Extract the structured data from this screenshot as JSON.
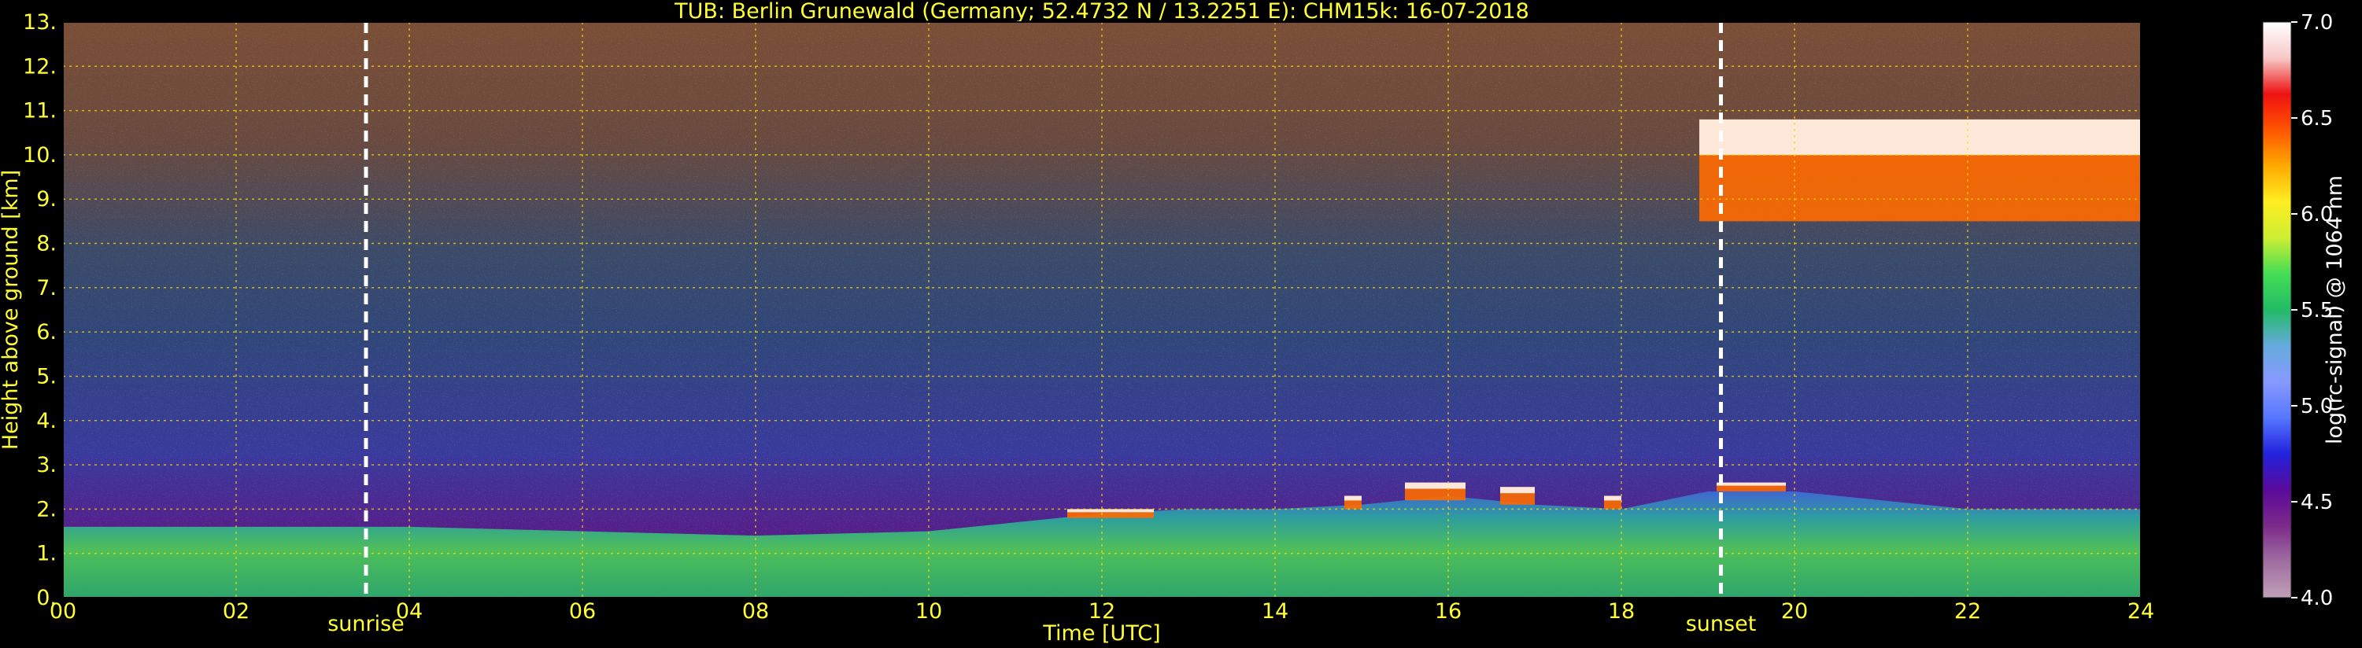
{
  "chart_data": {
    "type": "heatmap",
    "title": "TUB: Berlin Grunewald (Germany; 52.4732 N / 13.2251 E):    CHM15k: 16-07-2018",
    "xlabel": "Time [UTC]",
    "ylabel": "Height above ground [km]",
    "xlim": [
      0,
      24
    ],
    "ylim": [
      0,
      13
    ],
    "x_ticks": [
      "00",
      "02",
      "04",
      "06",
      "08",
      "10",
      "12",
      "14",
      "16",
      "18",
      "20",
      "22",
      "24"
    ],
    "y_ticks": [
      "0.",
      "1.",
      "2.",
      "3.",
      "4.",
      "5.",
      "6.",
      "7.",
      "8.",
      "9.",
      "10.",
      "11.",
      "12.",
      "13."
    ],
    "grid": true,
    "annotations": [
      {
        "label": "sunrise",
        "x": 3.5
      },
      {
        "label": "sunset",
        "x": 19.15
      }
    ],
    "colorbar": {
      "label": "log(rc-signal) @ 1064 nm",
      "range": [
        4.0,
        7.0
      ],
      "ticks": [
        "4.0",
        "4.5",
        "5.0",
        "5.5",
        "6.0",
        "6.5",
        "7.0"
      ],
      "colors": [
        "#c0a0b8",
        "#a06ea0",
        "#7c2a8a",
        "#5a0a9a",
        "#2222dd",
        "#5577ff",
        "#8899ff",
        "#66aadd",
        "#22bb66",
        "#44dd55",
        "#ccee33",
        "#ffee22",
        "#ffaa00",
        "#ff5500",
        "#ee1111",
        "#f8c8c8",
        "#ffffff"
      ]
    },
    "boundary_layer_top_km": [
      [
        0,
        1.6
      ],
      [
        2,
        1.6
      ],
      [
        4,
        1.6
      ],
      [
        6,
        1.5
      ],
      [
        8,
        1.4
      ],
      [
        10,
        1.5
      ],
      [
        11,
        1.7
      ],
      [
        12,
        1.9
      ],
      [
        13,
        2.0
      ],
      [
        14,
        2.0
      ],
      [
        15,
        2.1
      ],
      [
        16,
        2.3
      ],
      [
        17,
        2.1
      ],
      [
        18,
        2.0
      ],
      [
        19,
        2.4
      ],
      [
        20,
        2.4
      ],
      [
        21,
        2.2
      ],
      [
        22,
        2.0
      ],
      [
        24,
        2.0
      ]
    ],
    "cloud_layers": [
      {
        "t_start": 11.6,
        "t_end": 12.6,
        "base_km": 1.8,
        "top_km": 2.0
      },
      {
        "t_start": 14.8,
        "t_end": 15.0,
        "base_km": 2.0,
        "top_km": 2.3
      },
      {
        "t_start": 15.5,
        "t_end": 16.2,
        "base_km": 2.2,
        "top_km": 2.6
      },
      {
        "t_start": 16.6,
        "t_end": 17.0,
        "base_km": 2.1,
        "top_km": 2.5
      },
      {
        "t_start": 17.8,
        "t_end": 18.0,
        "base_km": 2.0,
        "top_km": 2.3
      },
      {
        "t_start": 19.1,
        "t_end": 19.9,
        "base_km": 2.4,
        "top_km": 2.6
      },
      {
        "t_start": 18.9,
        "t_end": 24.0,
        "base_km": 8.5,
        "top_km": 10.8
      }
    ]
  }
}
